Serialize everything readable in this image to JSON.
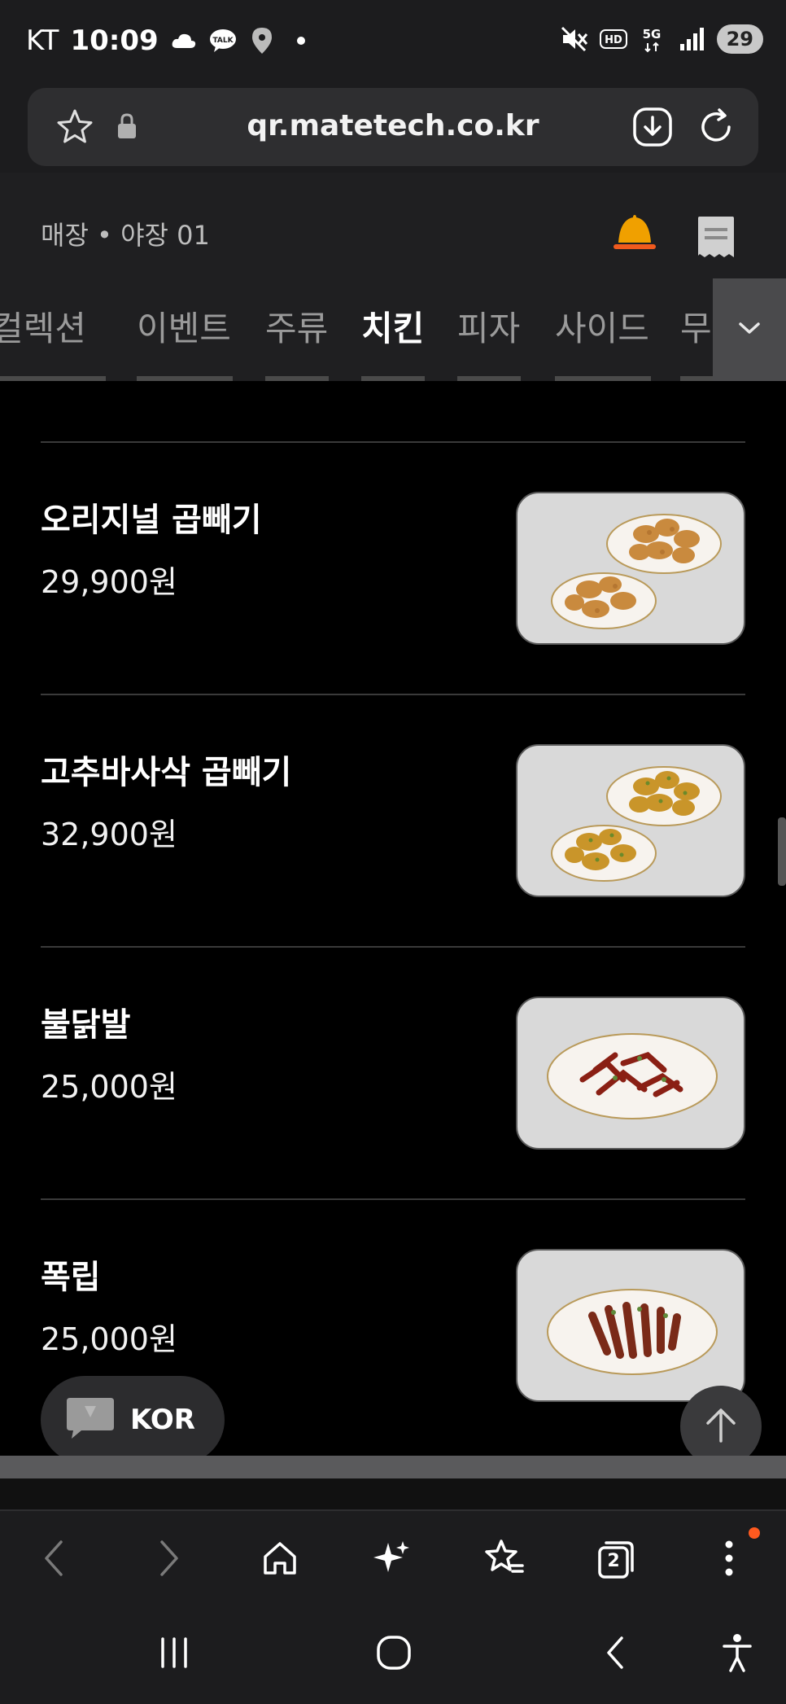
{
  "status_bar": {
    "carrier": "KT",
    "time": "10:09",
    "battery": "29",
    "network": "5G"
  },
  "browser": {
    "url": "qr.matetech.co.kr"
  },
  "store": {
    "name": "매장 • 야장 01"
  },
  "tabs": [
    {
      "label": "컬렉션",
      "active": false
    },
    {
      "label": "이벤트",
      "active": false
    },
    {
      "label": "주류",
      "active": false
    },
    {
      "label": "치킨",
      "active": true
    },
    {
      "label": "피자",
      "active": false
    },
    {
      "label": "사이드",
      "active": false
    },
    {
      "label": "무",
      "active": false
    }
  ],
  "menu_items": [
    {
      "name": "오리지널 곱빼기",
      "price": "29,900원",
      "image_icon": "fried-chicken-drumsticks-photo"
    },
    {
      "name": "고추바사삭 곱빼기",
      "price": "32,900원",
      "image_icon": "pepper-chicken-drumsticks-photo"
    },
    {
      "name": "불닭발",
      "price": "25,000원",
      "image_icon": "spicy-chicken-feet-photo"
    },
    {
      "name": "폭립",
      "price": "25,000원",
      "image_icon": "pork-ribs-photo"
    }
  ],
  "language_button": {
    "label": "KOR"
  },
  "toolbar": {
    "tabs_count": "2"
  },
  "colors": {
    "bell_accent": "#f0a000",
    "notification_dot": "#ff5a1f",
    "list_background": "#000000",
    "header_background": "#1f1f21"
  }
}
